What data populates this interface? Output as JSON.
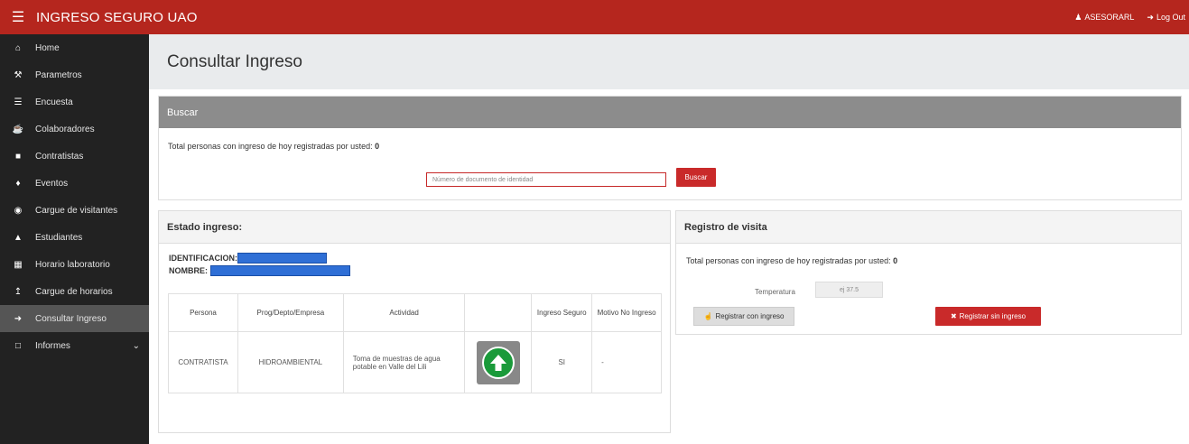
{
  "topbar": {
    "menu_icon": "hamburger-icon",
    "title": "INGRESO SEGURO UAO",
    "user": "ASESORARL",
    "logout": "Log Out",
    "color": "#b5261e"
  },
  "sidebar": {
    "items": [
      {
        "icon": "home-icon",
        "label": "Home"
      },
      {
        "icon": "wrench-icon",
        "label": "Parametros"
      },
      {
        "icon": "list-icon",
        "label": "Encuesta"
      },
      {
        "icon": "mug-icon",
        "label": "Colaboradores"
      },
      {
        "icon": "briefcase-icon",
        "label": "Contratistas"
      },
      {
        "icon": "pushpin-icon",
        "label": "Eventos"
      },
      {
        "icon": "record-icon",
        "label": "Cargue de visitantes"
      },
      {
        "icon": "graduation-cap-icon",
        "label": "Estudiantes"
      },
      {
        "icon": "calendar-icon",
        "label": "Horario laboratorio"
      },
      {
        "icon": "upload-icon",
        "label": "Cargue de horarios"
      },
      {
        "icon": "sign-in-icon",
        "label": "Consultar Ingreso"
      },
      {
        "icon": "file-icon",
        "label": "Informes"
      }
    ],
    "active_index": 10
  },
  "page": {
    "title": "Consultar Ingreso"
  },
  "buscar": {
    "header": "Buscar",
    "total_label": "Total personas con ingreso de hoy registradas por usted: ",
    "total_value": "0",
    "input_placeholder": "Número de documento de identidad",
    "button": "Buscar"
  },
  "estado": {
    "header": "Estado ingreso:",
    "id_label": "IDENTIFICACION:",
    "name_label": "NOMBRE:",
    "columns": [
      "Persona",
      "Prog/Depto/Empresa",
      "Actividad",
      "",
      "Ingreso Seguro",
      "Motivo No Ingreso"
    ],
    "row": {
      "persona": "CONTRATISTA",
      "empresa": "HIDROAMBIENTAL",
      "actividad": "Toma de muestras de agua potable en Valle del Lili",
      "icon": "green-up-arrow-icon",
      "ingreso": "SI",
      "motivo": "-"
    }
  },
  "registro": {
    "header": "Registro de visita",
    "total_label": "Total personas con ingreso de hoy registradas por usted: ",
    "total_value": "0",
    "temp_label": "Temperatura",
    "temp_placeholder": "ej 37.5",
    "btn_con": "Registrar con ingreso",
    "btn_sin": "Registrar sin ingreso"
  }
}
